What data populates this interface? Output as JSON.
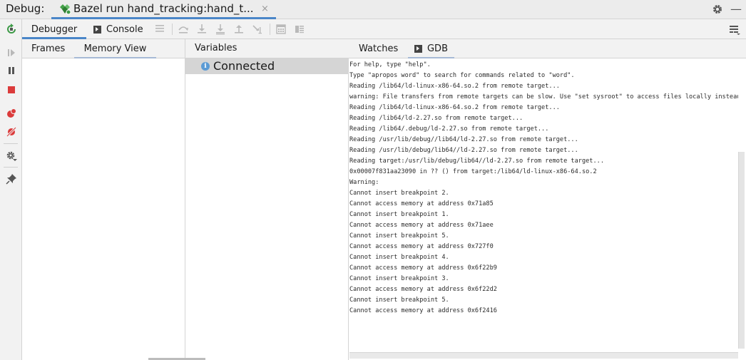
{
  "titlebar": {
    "debug_label": "Debug:",
    "run_tab_title": "Bazel run hand_tracking:hand_t...",
    "close_glyph": "×",
    "hide_glyph": "—"
  },
  "toolbar": {
    "tabs": [
      {
        "label": "Debugger",
        "active": true
      },
      {
        "label": "Console",
        "active": false
      }
    ]
  },
  "frames_panel": {
    "tabs": [
      {
        "label": "Frames",
        "active": false
      },
      {
        "label": "Memory View",
        "active": true
      }
    ]
  },
  "variables_panel": {
    "title": "Variables",
    "rows": [
      {
        "text": "Connected",
        "icon": "info-icon",
        "selected": true
      }
    ]
  },
  "gdb_panel": {
    "tabs": [
      {
        "label": "Watches",
        "active": false
      },
      {
        "label": "GDB",
        "active": true
      }
    ],
    "lines": [
      "For help, type \"help\".",
      "Type \"apropos word\" to search for commands related to \"word\".",
      "Reading /lib64/ld-linux-x86-64.so.2 from remote target...",
      "warning: File transfers from remote targets can be slow. Use \"set sysroot\" to access files locally instead.",
      "Reading /lib64/ld-linux-x86-64.so.2 from remote target...",
      "Reading /lib64/ld-2.27.so from remote target...",
      "Reading /lib64/.debug/ld-2.27.so from remote target...",
      "Reading /usr/lib/debug//lib64/ld-2.27.so from remote target...",
      "Reading /usr/lib/debug/lib64//ld-2.27.so from remote target...",
      "Reading target:/usr/lib/debug/lib64//ld-2.27.so from remote target...",
      "0x00007f831aa23090 in ?? () from target:/lib64/ld-linux-x86-64.so.2",
      "Warning:",
      "Cannot insert breakpoint 2.",
      "Cannot access memory at address 0x71a85",
      "Cannot insert breakpoint 1.",
      "Cannot access memory at address 0x71aee",
      "Cannot insert breakpoint 5.",
      "Cannot access memory at address 0x727f0",
      "Cannot insert breakpoint 4.",
      "Cannot access memory at address 0x6f22b9",
      "Cannot insert breakpoint 3.",
      "Cannot access memory at address 0x6f22d2",
      "Cannot insert breakpoint 5.",
      "Cannot access memory at address 0x6f2416"
    ]
  },
  "colors": {
    "accent": "#4a86c8",
    "rerun_green": "#3d9a47",
    "stop_red": "#db3b3b",
    "selected_row": "#d5d5d5"
  }
}
